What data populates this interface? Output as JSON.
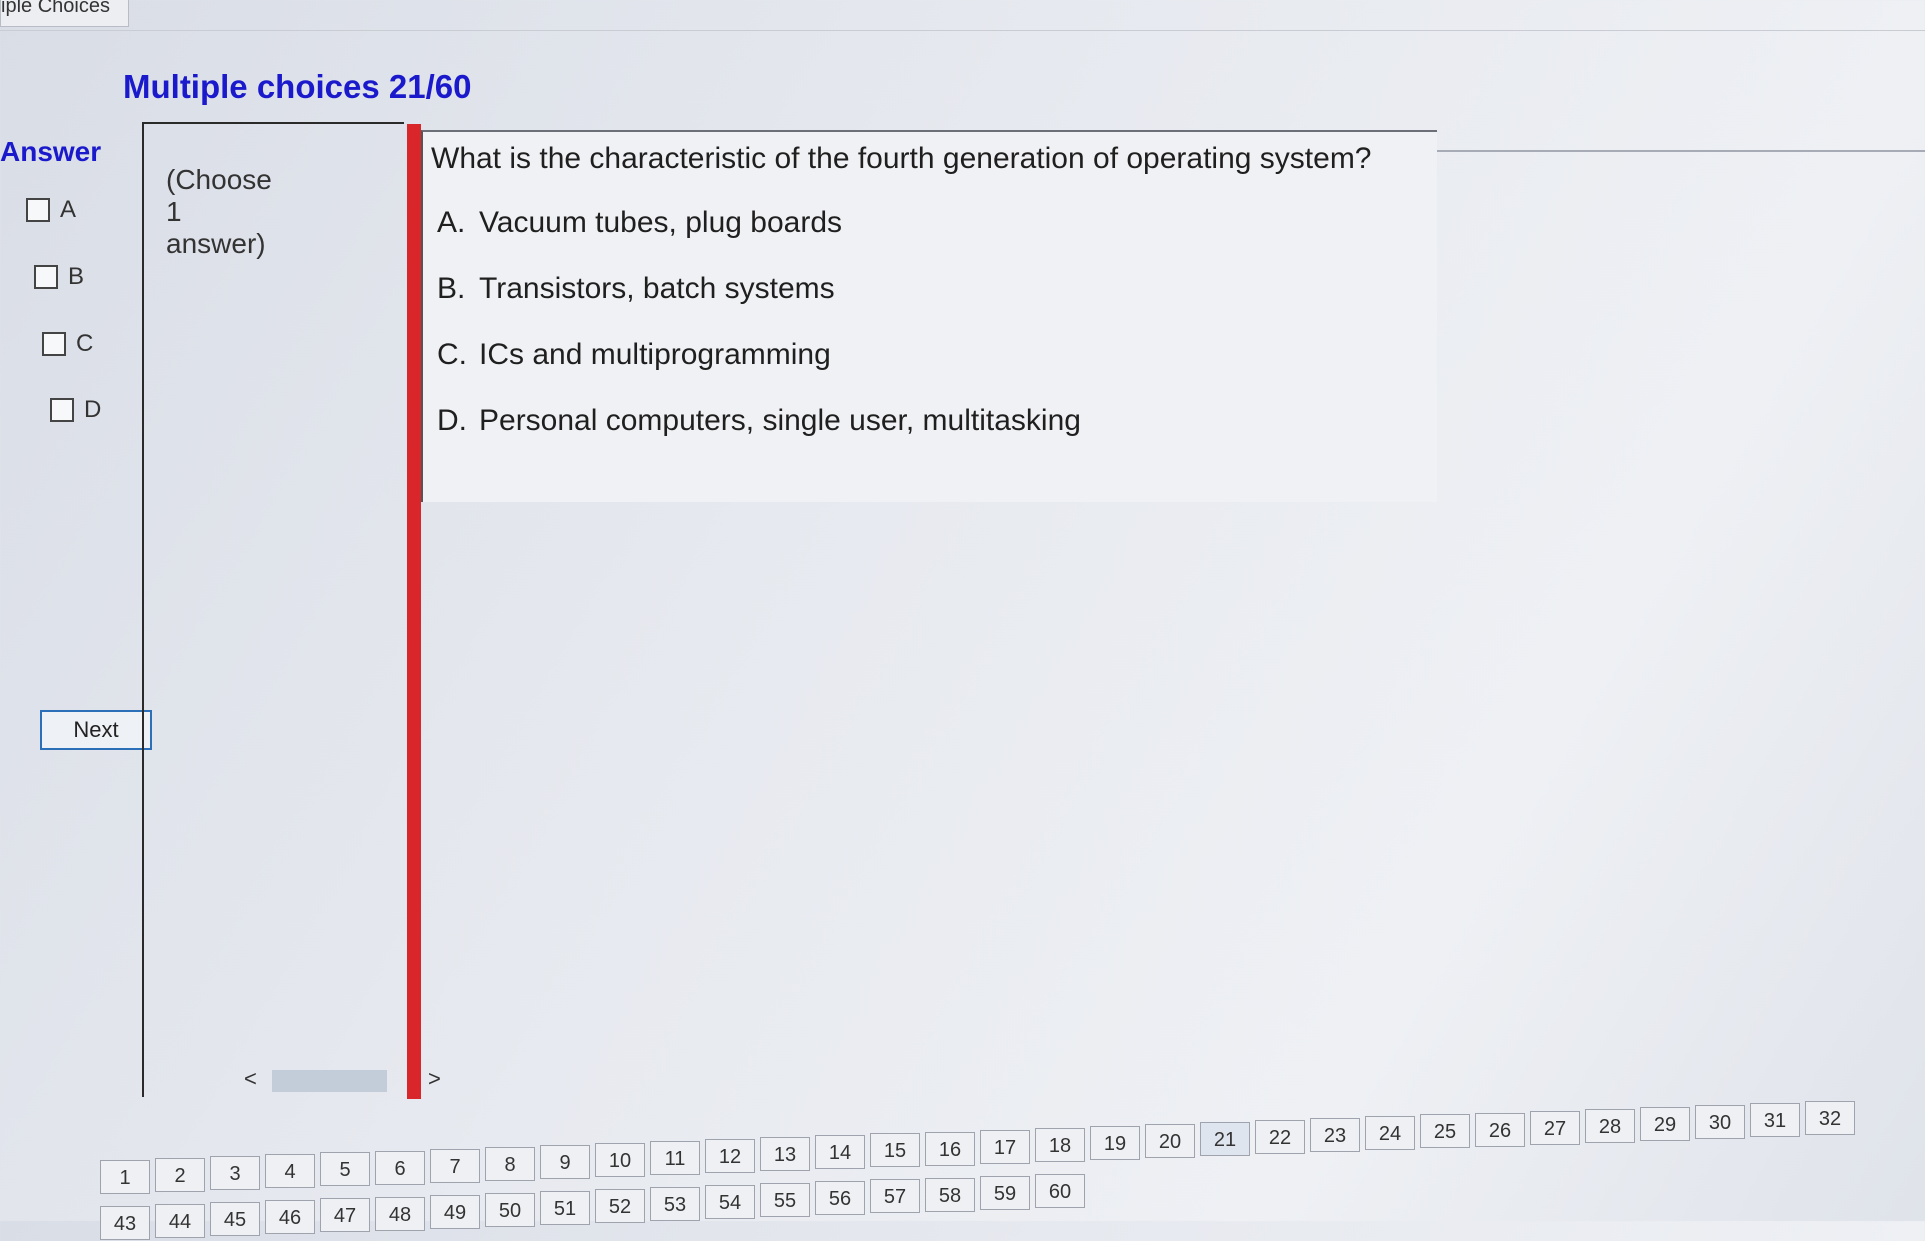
{
  "window": {
    "tab_label": "iple Choices"
  },
  "header": {
    "title": "Multiple choices 21/60"
  },
  "answer_panel": {
    "heading": "Answer",
    "options": [
      {
        "label": "A",
        "checked": false
      },
      {
        "label": "B",
        "checked": false
      },
      {
        "label": "C",
        "checked": false
      },
      {
        "label": "D",
        "checked": false
      }
    ],
    "next_label": "Next"
  },
  "hint": {
    "line1": "(Choose",
    "line2": "1",
    "line3": "answer)"
  },
  "scrollbar": {
    "left_arrow": "<",
    "right_arrow": ">"
  },
  "question": {
    "text": "What is the characteristic of the fourth generation of operating system?",
    "options": [
      {
        "letter": "A.",
        "text": "Vacuum tubes, plug boards"
      },
      {
        "letter": "B.",
        "text": "Transistors, batch systems"
      },
      {
        "letter": "C.",
        "text": "ICs and multiprogramming"
      },
      {
        "letter": "D.",
        "text": "Personal computers, single user, multitasking"
      }
    ]
  },
  "navigation": {
    "current": "21",
    "row1": [
      "1",
      "2",
      "3",
      "4",
      "5",
      "6",
      "7",
      "8",
      "9",
      "10",
      "11",
      "12",
      "13",
      "14",
      "15",
      "16",
      "17",
      "18",
      "19",
      "20",
      "21",
      "22",
      "23",
      "24",
      "25",
      "26",
      "27",
      "28",
      "29",
      "30",
      "31",
      "32"
    ],
    "row2": [
      "43",
      "44",
      "45",
      "46",
      "47",
      "48",
      "49",
      "50",
      "51",
      "52",
      "53",
      "54",
      "55",
      "56",
      "57",
      "58",
      "59",
      "60"
    ]
  }
}
